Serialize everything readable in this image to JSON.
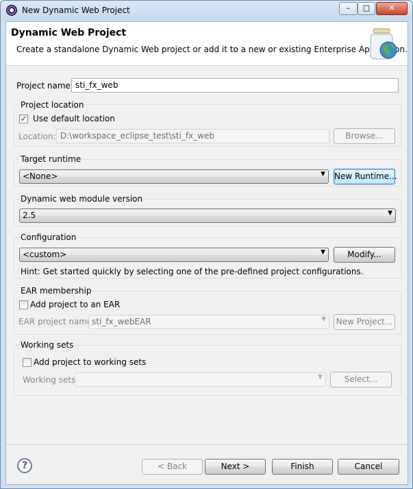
{
  "window": {
    "title": "New Dynamic Web Project",
    "minimize_glyph": "–",
    "maximize_glyph": "□",
    "close_glyph": "✕"
  },
  "header": {
    "title": "Dynamic Web Project",
    "description": "Create a standalone Dynamic Web project or add it to a new or existing Enterprise Application.",
    "icon": "jar-globe-icon"
  },
  "project_name": {
    "label": "Project name:",
    "value": "sti_fx_web"
  },
  "project_location": {
    "group_label": "Project location",
    "use_default_label": "Use default location",
    "use_default_checked": true,
    "location_label": "Location:",
    "location_value": "D:\\workspace_eclipse_test\\sti_fx_web",
    "browse_label": "Browse..."
  },
  "target_runtime": {
    "group_label": "Target runtime",
    "selected": "<None>",
    "new_runtime_label": "New Runtime..."
  },
  "module_version": {
    "group_label": "Dynamic web module version",
    "selected": "2.5"
  },
  "configuration": {
    "group_label": "Configuration",
    "selected": "<custom>",
    "modify_label": "Modify...",
    "hint": "Hint: Get started quickly by selecting one of the pre-defined project configurations."
  },
  "ear": {
    "group_label": "EAR membership",
    "add_label": "Add project to an EAR",
    "add_checked": false,
    "name_label": "EAR project name:",
    "name_value": "sti_fx_webEAR",
    "new_project_label": "New Project..."
  },
  "working_sets": {
    "group_label": "Working sets",
    "add_label": "Add project to working sets",
    "add_checked": false,
    "sets_label": "Working sets:",
    "sets_value": "",
    "select_label": "Select..."
  },
  "footer": {
    "help_glyph": "?",
    "back_label": "< Back",
    "next_label": "Next >",
    "finish_label": "Finish",
    "cancel_label": "Cancel"
  },
  "colors": {
    "frame": "#cfe0f1",
    "dialog_bg": "#f0f0f0",
    "focus_blue": "#3c7fb1"
  }
}
